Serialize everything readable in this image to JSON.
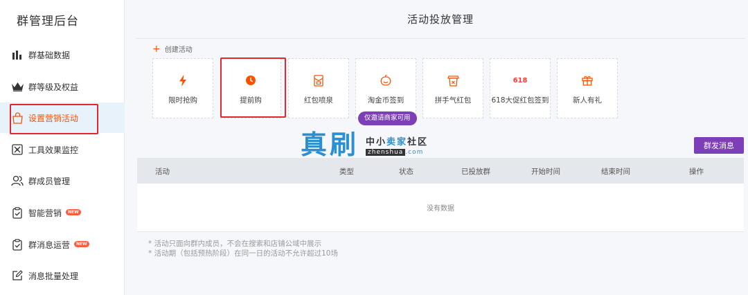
{
  "sidebar": {
    "brand": "群管理后台",
    "items": [
      {
        "label": "群基础数据",
        "icon": "bar-chart-icon"
      },
      {
        "label": "群等级及权益",
        "icon": "crown-icon"
      },
      {
        "label": "设置营销活动",
        "icon": "shopping-bag-icon",
        "active": true
      },
      {
        "label": "工具效果监控",
        "icon": "monitor-icon"
      },
      {
        "label": "群成员管理",
        "icon": "users-icon"
      },
      {
        "label": "智能营销",
        "icon": "clipboard-check-icon",
        "badge": "NEW"
      },
      {
        "label": "群消息运营",
        "icon": "clipboard-check-icon",
        "badge": "NEW"
      },
      {
        "label": "消息批量处理",
        "icon": "edit-icon"
      }
    ]
  },
  "main": {
    "title": "活动投放管理",
    "create_label": "创建活动",
    "cards": [
      {
        "label": "限时抢购",
        "icon": "lightning-icon"
      },
      {
        "label": "提前购",
        "icon": "clock-icon"
      },
      {
        "label": "红包喷泉",
        "icon": "red-packet-icon"
      },
      {
        "label": "淘金币签到",
        "icon": "coin-icon"
      },
      {
        "label": "拼手气红包",
        "icon": "gift-packet-icon"
      },
      {
        "label": "618大促红包签到",
        "icon_text": "618"
      },
      {
        "label": "新人有礼",
        "icon": "gift-icon"
      }
    ],
    "invite_pill": "仅邀请商家可用",
    "broadcast_button": "群发消息",
    "table": {
      "headers": [
        "活动",
        "类型",
        "状态",
        "已投放群",
        "开始时间",
        "结束时间",
        "操作"
      ],
      "empty": "没有数据"
    },
    "notes": [
      "* 活动只面向群内成员，不会在搜索和店铺公域中展示",
      "* 活动期（包括预热阶段）在同一日的活动不允许超过10场"
    ]
  },
  "watermark": {
    "big": "真刷",
    "cn_prefix": "中小",
    "cn_highlight": "卖家",
    "cn_suffix": "社区",
    "en_box": "zhenshua",
    "en_suffix": ".com"
  },
  "colors": {
    "accent_orange": "#ff5000",
    "purple": "#7d3fb8",
    "highlight_red": "#e5242b",
    "brand_blue": "#2b8fd1"
  }
}
